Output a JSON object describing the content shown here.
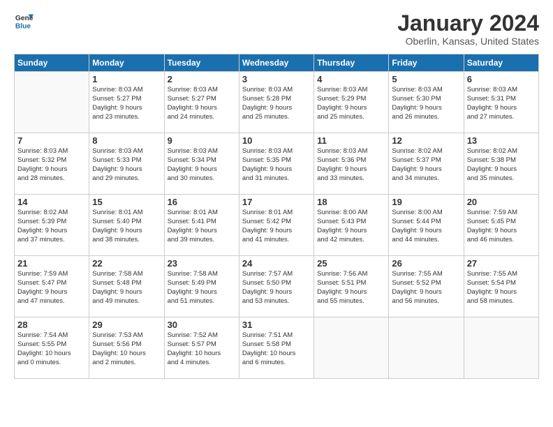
{
  "logo": {
    "general": "General",
    "blue": "Blue"
  },
  "header": {
    "title": "January 2024",
    "location": "Oberlin, Kansas, United States"
  },
  "weekdays": [
    "Sunday",
    "Monday",
    "Tuesday",
    "Wednesday",
    "Thursday",
    "Friday",
    "Saturday"
  ],
  "weeks": [
    [
      {
        "num": "",
        "lines": []
      },
      {
        "num": "1",
        "lines": [
          "Sunrise: 8:03 AM",
          "Sunset: 5:27 PM",
          "Daylight: 9 hours",
          "and 23 minutes."
        ]
      },
      {
        "num": "2",
        "lines": [
          "Sunrise: 8:03 AM",
          "Sunset: 5:27 PM",
          "Daylight: 9 hours",
          "and 24 minutes."
        ]
      },
      {
        "num": "3",
        "lines": [
          "Sunrise: 8:03 AM",
          "Sunset: 5:28 PM",
          "Daylight: 9 hours",
          "and 25 minutes."
        ]
      },
      {
        "num": "4",
        "lines": [
          "Sunrise: 8:03 AM",
          "Sunset: 5:29 PM",
          "Daylight: 9 hours",
          "and 25 minutes."
        ]
      },
      {
        "num": "5",
        "lines": [
          "Sunrise: 8:03 AM",
          "Sunset: 5:30 PM",
          "Daylight: 9 hours",
          "and 26 minutes."
        ]
      },
      {
        "num": "6",
        "lines": [
          "Sunrise: 8:03 AM",
          "Sunset: 5:31 PM",
          "Daylight: 9 hours",
          "and 27 minutes."
        ]
      }
    ],
    [
      {
        "num": "7",
        "lines": [
          "Sunrise: 8:03 AM",
          "Sunset: 5:32 PM",
          "Daylight: 9 hours",
          "and 28 minutes."
        ]
      },
      {
        "num": "8",
        "lines": [
          "Sunrise: 8:03 AM",
          "Sunset: 5:33 PM",
          "Daylight: 9 hours",
          "and 29 minutes."
        ]
      },
      {
        "num": "9",
        "lines": [
          "Sunrise: 8:03 AM",
          "Sunset: 5:34 PM",
          "Daylight: 9 hours",
          "and 30 minutes."
        ]
      },
      {
        "num": "10",
        "lines": [
          "Sunrise: 8:03 AM",
          "Sunset: 5:35 PM",
          "Daylight: 9 hours",
          "and 31 minutes."
        ]
      },
      {
        "num": "11",
        "lines": [
          "Sunrise: 8:03 AM",
          "Sunset: 5:36 PM",
          "Daylight: 9 hours",
          "and 33 minutes."
        ]
      },
      {
        "num": "12",
        "lines": [
          "Sunrise: 8:02 AM",
          "Sunset: 5:37 PM",
          "Daylight: 9 hours",
          "and 34 minutes."
        ]
      },
      {
        "num": "13",
        "lines": [
          "Sunrise: 8:02 AM",
          "Sunset: 5:38 PM",
          "Daylight: 9 hours",
          "and 35 minutes."
        ]
      }
    ],
    [
      {
        "num": "14",
        "lines": [
          "Sunrise: 8:02 AM",
          "Sunset: 5:39 PM",
          "Daylight: 9 hours",
          "and 37 minutes."
        ]
      },
      {
        "num": "15",
        "lines": [
          "Sunrise: 8:01 AM",
          "Sunset: 5:40 PM",
          "Daylight: 9 hours",
          "and 38 minutes."
        ]
      },
      {
        "num": "16",
        "lines": [
          "Sunrise: 8:01 AM",
          "Sunset: 5:41 PM",
          "Daylight: 9 hours",
          "and 39 minutes."
        ]
      },
      {
        "num": "17",
        "lines": [
          "Sunrise: 8:01 AM",
          "Sunset: 5:42 PM",
          "Daylight: 9 hours",
          "and 41 minutes."
        ]
      },
      {
        "num": "18",
        "lines": [
          "Sunrise: 8:00 AM",
          "Sunset: 5:43 PM",
          "Daylight: 9 hours",
          "and 42 minutes."
        ]
      },
      {
        "num": "19",
        "lines": [
          "Sunrise: 8:00 AM",
          "Sunset: 5:44 PM",
          "Daylight: 9 hours",
          "and 44 minutes."
        ]
      },
      {
        "num": "20",
        "lines": [
          "Sunrise: 7:59 AM",
          "Sunset: 5:45 PM",
          "Daylight: 9 hours",
          "and 46 minutes."
        ]
      }
    ],
    [
      {
        "num": "21",
        "lines": [
          "Sunrise: 7:59 AM",
          "Sunset: 5:47 PM",
          "Daylight: 9 hours",
          "and 47 minutes."
        ]
      },
      {
        "num": "22",
        "lines": [
          "Sunrise: 7:58 AM",
          "Sunset: 5:48 PM",
          "Daylight: 9 hours",
          "and 49 minutes."
        ]
      },
      {
        "num": "23",
        "lines": [
          "Sunrise: 7:58 AM",
          "Sunset: 5:49 PM",
          "Daylight: 9 hours",
          "and 51 minutes."
        ]
      },
      {
        "num": "24",
        "lines": [
          "Sunrise: 7:57 AM",
          "Sunset: 5:50 PM",
          "Daylight: 9 hours",
          "and 53 minutes."
        ]
      },
      {
        "num": "25",
        "lines": [
          "Sunrise: 7:56 AM",
          "Sunset: 5:51 PM",
          "Daylight: 9 hours",
          "and 55 minutes."
        ]
      },
      {
        "num": "26",
        "lines": [
          "Sunrise: 7:55 AM",
          "Sunset: 5:52 PM",
          "Daylight: 9 hours",
          "and 56 minutes."
        ]
      },
      {
        "num": "27",
        "lines": [
          "Sunrise: 7:55 AM",
          "Sunset: 5:54 PM",
          "Daylight: 9 hours",
          "and 58 minutes."
        ]
      }
    ],
    [
      {
        "num": "28",
        "lines": [
          "Sunrise: 7:54 AM",
          "Sunset: 5:55 PM",
          "Daylight: 10 hours",
          "and 0 minutes."
        ]
      },
      {
        "num": "29",
        "lines": [
          "Sunrise: 7:53 AM",
          "Sunset: 5:56 PM",
          "Daylight: 10 hours",
          "and 2 minutes."
        ]
      },
      {
        "num": "30",
        "lines": [
          "Sunrise: 7:52 AM",
          "Sunset: 5:57 PM",
          "Daylight: 10 hours",
          "and 4 minutes."
        ]
      },
      {
        "num": "31",
        "lines": [
          "Sunrise: 7:51 AM",
          "Sunset: 5:58 PM",
          "Daylight: 10 hours",
          "and 6 minutes."
        ]
      },
      {
        "num": "",
        "lines": []
      },
      {
        "num": "",
        "lines": []
      },
      {
        "num": "",
        "lines": []
      }
    ]
  ]
}
